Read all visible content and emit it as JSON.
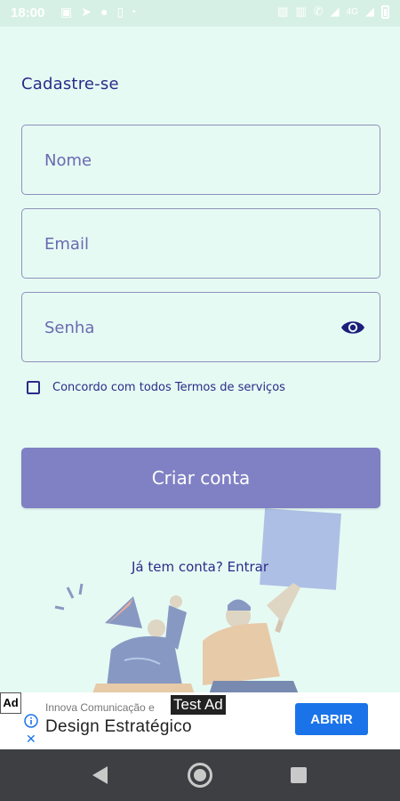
{
  "status_bar": {
    "time": "18:00",
    "network": "4G",
    "icons": [
      "image-icon",
      "telegram-icon",
      "app-icon",
      "sim-icon",
      "nfc-icon",
      "vibrate-icon",
      "wifi-call-icon",
      "signal-icon",
      "battery-icon"
    ]
  },
  "form": {
    "title": "Cadastre-se",
    "name_placeholder": "Nome",
    "email_placeholder": "Email",
    "password_placeholder": "Senha",
    "terms_label": "Concordo com todos Termos de serviços",
    "terms_checked": false,
    "create_button": "Criar conta",
    "login_link": "Já tem conta? Entrar"
  },
  "ad": {
    "badge": "Ad",
    "test_label": "Test Ad",
    "advertiser": "Innova Comunicação e",
    "title": "Design Estratégico",
    "cta": "ABRIR"
  },
  "colors": {
    "background": "#e6faf4",
    "accent": "#8080c4",
    "text": "#2b2b88",
    "ad_cta": "#1a73e8"
  }
}
